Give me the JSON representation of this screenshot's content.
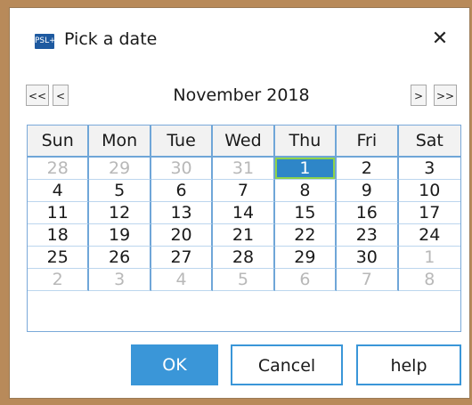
{
  "window": {
    "title": "Pick a date",
    "app_icon_text": "PSL+",
    "close_glyph": "✕"
  },
  "nav": {
    "prev_year": "<<",
    "prev_month": "<",
    "next_month": ">",
    "next_year": ">>",
    "month_label": "November 2018"
  },
  "calendar": {
    "weekdays": [
      "Sun",
      "Mon",
      "Tue",
      "Wed",
      "Thu",
      "Fri",
      "Sat"
    ],
    "weeks": [
      [
        {
          "d": "28",
          "other": true
        },
        {
          "d": "29",
          "other": true
        },
        {
          "d": "30",
          "other": true
        },
        {
          "d": "31",
          "other": true
        },
        {
          "d": "1",
          "selected": true
        },
        {
          "d": "2"
        },
        {
          "d": "3"
        }
      ],
      [
        {
          "d": "4"
        },
        {
          "d": "5"
        },
        {
          "d": "6"
        },
        {
          "d": "7"
        },
        {
          "d": "8"
        },
        {
          "d": "9"
        },
        {
          "d": "10"
        }
      ],
      [
        {
          "d": "11"
        },
        {
          "d": "12"
        },
        {
          "d": "13"
        },
        {
          "d": "14"
        },
        {
          "d": "15"
        },
        {
          "d": "16"
        },
        {
          "d": "17"
        }
      ],
      [
        {
          "d": "18"
        },
        {
          "d": "19"
        },
        {
          "d": "20"
        },
        {
          "d": "21"
        },
        {
          "d": "22"
        },
        {
          "d": "23"
        },
        {
          "d": "24"
        }
      ],
      [
        {
          "d": "25"
        },
        {
          "d": "26"
        },
        {
          "d": "27"
        },
        {
          "d": "28"
        },
        {
          "d": "29"
        },
        {
          "d": "30"
        },
        {
          "d": "1",
          "other": true
        }
      ],
      [
        {
          "d": "2",
          "other": true
        },
        {
          "d": "3",
          "other": true
        },
        {
          "d": "4",
          "other": true
        },
        {
          "d": "5",
          "other": true
        },
        {
          "d": "6",
          "other": true
        },
        {
          "d": "7",
          "other": true
        },
        {
          "d": "8",
          "other": true
        }
      ]
    ]
  },
  "buttons": {
    "ok": "OK",
    "cancel": "Cancel",
    "help": "help"
  },
  "colors": {
    "accent": "#3a96d8",
    "selected_day": "#2e86c8",
    "selected_outline": "#8ed24a"
  }
}
